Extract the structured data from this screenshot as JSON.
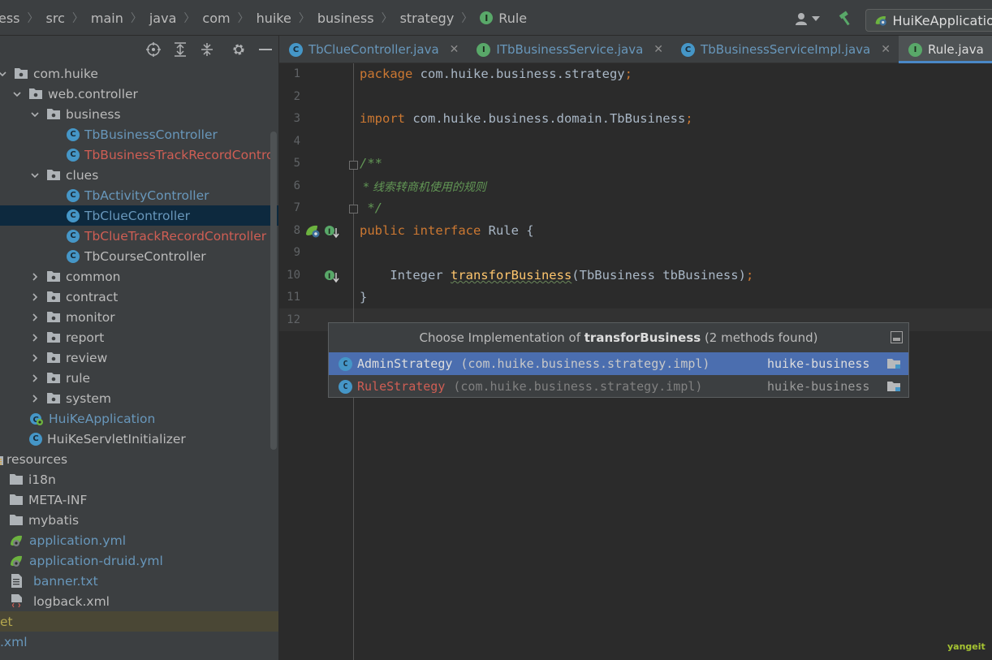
{
  "breadcrumb": {
    "items": [
      "ess",
      "src",
      "main",
      "java",
      "com",
      "huike",
      "business",
      "strategy"
    ],
    "current": "Rule",
    "current_icon": "interface-icon"
  },
  "toolbar": {
    "run_config_label": "HuiKeApplication"
  },
  "project_tree": {
    "rows": [
      {
        "label": "com.huike",
        "indent": 0,
        "chev": "down",
        "icon": "package",
        "color": "default"
      },
      {
        "label": "web.controller",
        "indent": 1,
        "chev": "down",
        "icon": "package",
        "color": "default"
      },
      {
        "label": "business",
        "indent": 2,
        "chev": "down",
        "icon": "package",
        "color": "default"
      },
      {
        "label": "TbBusinessController",
        "indent": 3,
        "chev": "none",
        "icon": "class",
        "color": "blue"
      },
      {
        "label": "TbBusinessTrackRecordController",
        "indent": 3,
        "chev": "none",
        "icon": "class",
        "color": "red"
      },
      {
        "label": "clues",
        "indent": 2,
        "chev": "down",
        "icon": "package",
        "color": "default"
      },
      {
        "label": "TbActivityController",
        "indent": 3,
        "chev": "none",
        "icon": "class",
        "color": "blue"
      },
      {
        "label": "TbClueController",
        "indent": 3,
        "chev": "none",
        "icon": "class",
        "color": "blue",
        "selected": true
      },
      {
        "label": "TbClueTrackRecordController",
        "indent": 3,
        "chev": "none",
        "icon": "class",
        "color": "red"
      },
      {
        "label": "TbCourseController",
        "indent": 3,
        "chev": "none",
        "icon": "class",
        "color": "default"
      },
      {
        "label": "common",
        "indent": 2,
        "chev": "right",
        "icon": "package",
        "color": "default"
      },
      {
        "label": "contract",
        "indent": 2,
        "chev": "right",
        "icon": "package",
        "color": "default"
      },
      {
        "label": "monitor",
        "indent": 2,
        "chev": "right",
        "icon": "package",
        "color": "default"
      },
      {
        "label": "report",
        "indent": 2,
        "chev": "right",
        "icon": "package",
        "color": "default"
      },
      {
        "label": "review",
        "indent": 2,
        "chev": "right",
        "icon": "package",
        "color": "default"
      },
      {
        "label": "rule",
        "indent": 2,
        "chev": "right",
        "icon": "package",
        "color": "default"
      },
      {
        "label": "system",
        "indent": 2,
        "chev": "right",
        "icon": "package",
        "color": "default"
      },
      {
        "label": "HuiKeApplication",
        "indent": 1,
        "chev": "none",
        "icon": "spring-class",
        "color": "blue"
      },
      {
        "label": "HuiKeServletInitializer",
        "indent": 1,
        "chev": "none",
        "icon": "class",
        "color": "default"
      },
      {
        "label": "resources",
        "indent": -1,
        "chev": "none",
        "icon": "resources",
        "color": "default"
      },
      {
        "label": "i18n",
        "indent": 0,
        "chev": "none",
        "icon": "folder",
        "color": "default"
      },
      {
        "label": "META-INF",
        "indent": 0,
        "chev": "none",
        "icon": "folder",
        "color": "default"
      },
      {
        "label": "mybatis",
        "indent": 0,
        "chev": "none",
        "icon": "folder",
        "color": "default"
      },
      {
        "label": "application.yml",
        "indent": 0,
        "chev": "none",
        "icon": "spring-yml",
        "color": "blue"
      },
      {
        "label": "application-druid.yml",
        "indent": 0,
        "chev": "none",
        "icon": "spring-yml",
        "color": "blue"
      },
      {
        "label": "banner.txt",
        "indent": 0,
        "chev": "none",
        "icon": "text-file",
        "color": "blue"
      },
      {
        "label": "logback.xml",
        "indent": 0,
        "chev": "none",
        "icon": "xml-file",
        "color": "default"
      },
      {
        "label": "et",
        "indent": -2,
        "chev": "none",
        "icon": "none",
        "color": "yellow",
        "vcs": true
      },
      {
        "label": ".xml",
        "indent": -2,
        "chev": "none",
        "icon": "none",
        "color": "blue"
      }
    ]
  },
  "tabs": [
    {
      "label": "TbClueController.java",
      "type": "class",
      "active": false
    },
    {
      "label": "ITbBusinessService.java",
      "type": "interface",
      "active": false
    },
    {
      "label": "TbBusinessServiceImpl.java",
      "type": "class",
      "active": false
    },
    {
      "label": "Rule.java",
      "type": "interface",
      "active": true
    }
  ],
  "editor": {
    "line_numbers": [
      "1",
      "2",
      "3",
      "4",
      "5",
      "6",
      "7",
      "8",
      "9",
      "10",
      "11",
      "12"
    ],
    "lines": {
      "l1_kw": "package",
      "l1_rest": " com.huike.business.strategy",
      "l1_semi": ";",
      "l3_kw": "import",
      "l3_rest": " com.huike.business.domain.TbBusiness",
      "l3_semi": ";",
      "l5": "/**",
      "l6": " * 线索转商机使用的规则",
      "l7": " */",
      "l8_kw": "public interface",
      "l8_rest": " Rule {",
      "l10_type": "    Integer ",
      "l10_fn": "transforBusiness",
      "l10_rest": "(TbBusiness tbBusiness)",
      "l10_semi": ";",
      "l11": "}"
    }
  },
  "popup": {
    "title_prefix": "Choose Implementation of ",
    "title_method": "transforBusiness",
    "title_suffix": " (2 methods found)",
    "items": [
      {
        "name": "AdminStrategy",
        "package": "(com.huike.business.strategy.impl)",
        "module": "huike-business",
        "selected": true
      },
      {
        "name": "RuleStrategy",
        "package": "(com.huike.business.strategy.impl)",
        "module": "huike-business",
        "selected": false
      }
    ]
  },
  "watermark": "yangeit",
  "colors": {
    "accent_blue": "#4a88c7",
    "class_icon": "#4596c7",
    "interface_icon": "#59a869",
    "keyword": "#cc7832",
    "comment": "#629755",
    "method": "#ffc66d",
    "error_red": "#cf5e54",
    "selection": "#4b6eaf"
  }
}
